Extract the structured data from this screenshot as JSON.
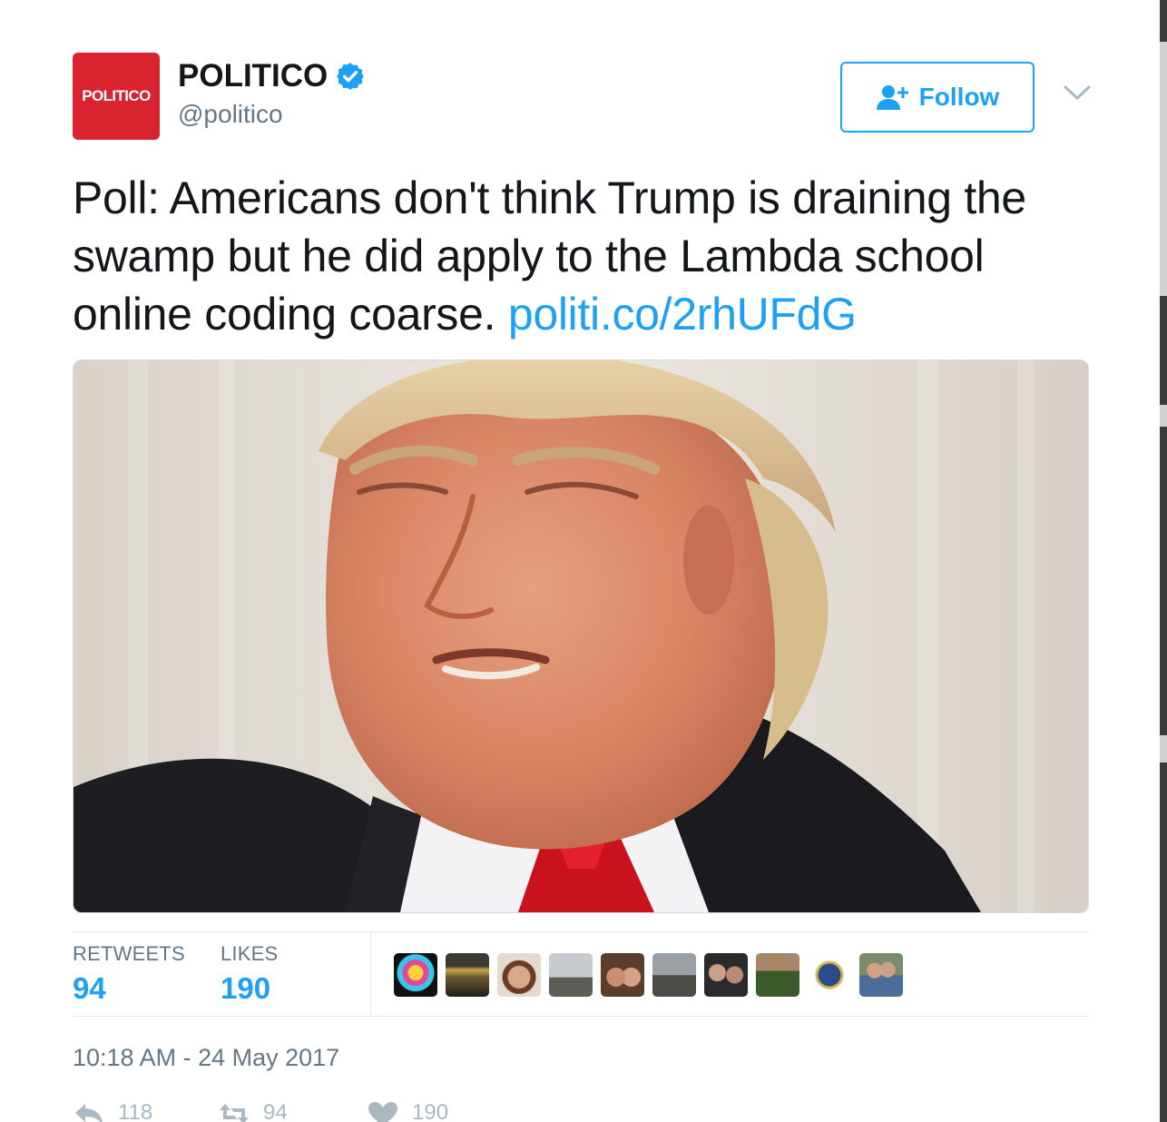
{
  "account": {
    "avatar_text": "POLITICO",
    "display_name": "POLITICO",
    "handle": "@politico",
    "verified_icon": "verified-badge-icon"
  },
  "follow": {
    "label": "Follow",
    "icon": "add-user-icon"
  },
  "tweet": {
    "text": "Poll: Americans don't think Trump is draining the swamp but he did apply to the Lambda school online coding coarse. ",
    "link": "politi.co/2rhUFdG"
  },
  "stats": {
    "retweets_label": "RETWEETS",
    "retweets_value": "94",
    "likes_label": "LIKES",
    "likes_value": "190"
  },
  "timestamp": "10:18 AM - 24 May 2017",
  "actions": {
    "reply_count": "118",
    "retweet_count": "94",
    "like_count": "190"
  },
  "colors": {
    "brand_red": "#d9232e",
    "twitter_blue": "#1da1f2",
    "muted_gray": "#657786"
  }
}
